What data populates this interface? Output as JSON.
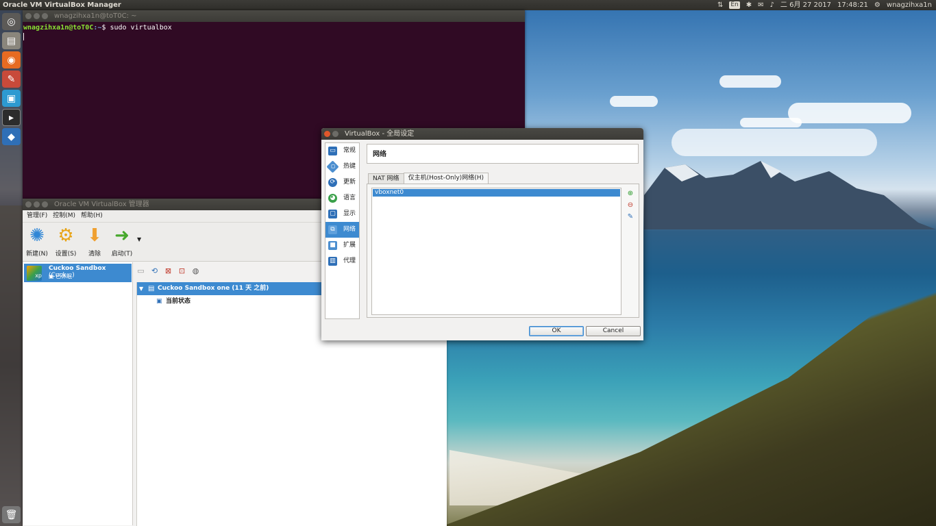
{
  "top_panel": {
    "app_title": "Oracle VM VirtualBox Manager",
    "keyboard_layout": "En",
    "date": "二 6月 27 2017",
    "time": "17:48:21",
    "user": "wnagzihxa1n"
  },
  "launcher": {
    "items": [
      "ubuntu-dash-icon",
      "files-icon",
      "firefox-icon",
      "system-settings-icon",
      "vm-window-icon",
      "terminal-icon",
      "virtualbox-icon",
      "trash-icon"
    ]
  },
  "terminal": {
    "title": "wnagzihxa1n@toT0C: ~",
    "prompt_user": "wnagzihxa1n@toT0C",
    "prompt_path": ":~",
    "prompt_symbol": "$ ",
    "command": "sudo virtualbox"
  },
  "vbox_manager": {
    "title": "Oracle VM VirtualBox 管理器",
    "menu": [
      "管理(F)",
      "控制(M)",
      "帮助(H)"
    ],
    "toolbar": {
      "new_label": "新建(N)",
      "settings_label": "设置(S)",
      "discard_label": "清除",
      "start_label": "启动(T)"
    },
    "vm": {
      "name": "Cuckoo Sandbox",
      "name_suffix": "(Cuck...)",
      "state": "已休眠",
      "os_badge": "xp"
    },
    "snapshot": {
      "name": "Cuckoo Sandbox one (11 天 之前)",
      "current_state": "当前状态"
    }
  },
  "settings_dialog": {
    "title": "VirtualBox - 全局设定",
    "categories": [
      "常规",
      "热键",
      "更新",
      "语言",
      "显示",
      "网络",
      "扩展",
      "代理"
    ],
    "selected_category": "网络",
    "page_header": "网络",
    "tabs": [
      "NAT 网络",
      "仅主机(Host-Only)网络(H)"
    ],
    "active_tab": "仅主机(Host-Only)网络(H)",
    "networks": [
      "vboxnet0"
    ],
    "ok_label": "OK",
    "cancel_label": "Cancel"
  },
  "colors": {
    "selection": "#3d8ad0",
    "terminal_bg": "#300a24",
    "panel_bg": "#3c3b37"
  }
}
